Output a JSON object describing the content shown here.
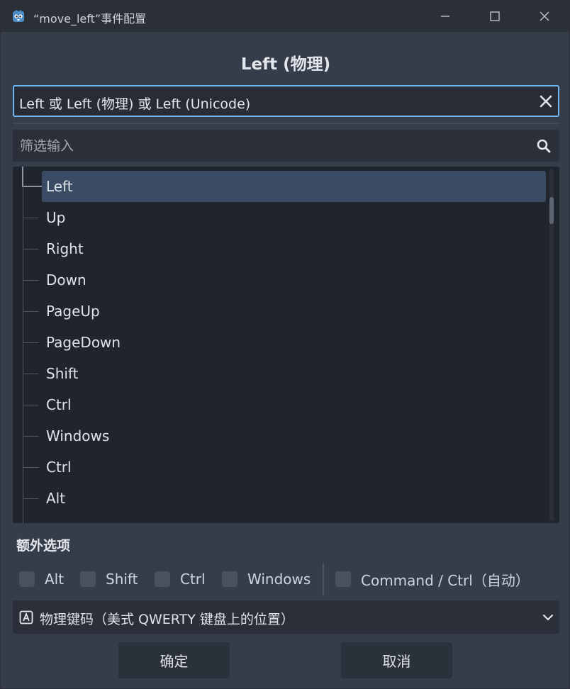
{
  "window": {
    "title": "“move_left”事件配置",
    "controls": {
      "minimize": "minimize-icon",
      "maximize": "maximize-icon",
      "close": "close-icon"
    }
  },
  "dialog": {
    "heading": "Left (物理)",
    "event_display": "Left 或 Left (物理) 或 Left (Unicode)",
    "filter_placeholder": "筛选输入"
  },
  "tree": {
    "items": [
      {
        "label": "Left",
        "selected": true
      },
      {
        "label": "Up"
      },
      {
        "label": "Right"
      },
      {
        "label": "Down"
      },
      {
        "label": "PageUp"
      },
      {
        "label": "PageDown"
      },
      {
        "label": "Shift"
      },
      {
        "label": "Ctrl"
      },
      {
        "label": "Windows"
      },
      {
        "label": "Ctrl"
      },
      {
        "label": "Alt"
      }
    ]
  },
  "extra_options": {
    "heading": "额外选项",
    "modifiers": [
      {
        "label": "Alt",
        "checked": false
      },
      {
        "label": "Shift",
        "checked": false
      },
      {
        "label": "Ctrl",
        "checked": false
      },
      {
        "label": "Windows",
        "checked": false
      },
      {
        "label": "Command / Ctrl（自动）",
        "checked": false
      }
    ]
  },
  "location": {
    "selected": "物理键码（美式 QWERTY 键盘上的位置）"
  },
  "buttons": {
    "ok": "确定",
    "cancel": "取消"
  },
  "colors": {
    "accent": "#70b6f2",
    "selection": "#3a4c64",
    "background": "#363d4a"
  }
}
